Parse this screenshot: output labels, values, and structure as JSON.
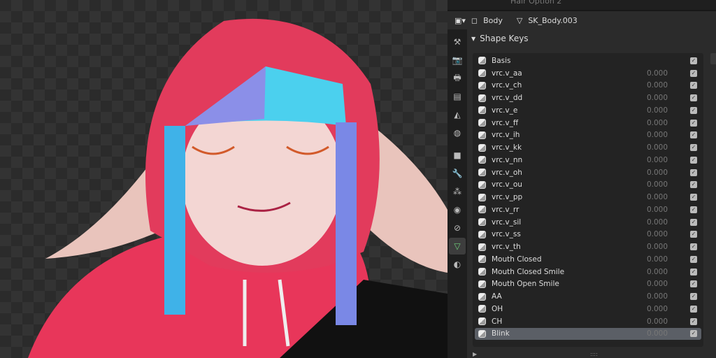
{
  "topbar": {
    "text": "Hair Option 2"
  },
  "header": {
    "object": "Body",
    "mesh": "SK_Body.003"
  },
  "panel": {
    "title": "Shape Keys"
  },
  "tabs": [
    "tool",
    "render",
    "output",
    "view-layer",
    "scene",
    "world",
    "object",
    "modifier",
    "particles",
    "physics",
    "constraints",
    "data",
    "material"
  ],
  "shape_keys": [
    {
      "name": "Basis",
      "value": "",
      "checked": true
    },
    {
      "name": "vrc.v_aa",
      "value": "0.000"
    },
    {
      "name": "vrc.v_ch",
      "value": "0.000"
    },
    {
      "name": "vrc.v_dd",
      "value": "0.000"
    },
    {
      "name": "vrc.v_e",
      "value": "0.000"
    },
    {
      "name": "vrc.v_ff",
      "value": "0.000"
    },
    {
      "name": "vrc.v_ih",
      "value": "0.000"
    },
    {
      "name": "vrc.v_kk",
      "value": "0.000"
    },
    {
      "name": "vrc.v_nn",
      "value": "0.000"
    },
    {
      "name": "vrc.v_oh",
      "value": "0.000"
    },
    {
      "name": "vrc.v_ou",
      "value": "0.000"
    },
    {
      "name": "vrc.v_pp",
      "value": "0.000"
    },
    {
      "name": "vrc.v_rr",
      "value": "0.000"
    },
    {
      "name": "vrc.v_sil",
      "value": "0.000"
    },
    {
      "name": "vrc.v_ss",
      "value": "0.000"
    },
    {
      "name": "vrc.v_th",
      "value": "0.000"
    },
    {
      "name": "Mouth Closed",
      "value": "0.000"
    },
    {
      "name": "Mouth Closed Smile",
      "value": "0.000"
    },
    {
      "name": "Mouth Open Smile",
      "value": "0.000"
    },
    {
      "name": "AA",
      "value": "0.000"
    },
    {
      "name": "OH",
      "value": "0.000"
    },
    {
      "name": "CH",
      "value": "0.000"
    },
    {
      "name": "Blink",
      "value": "0.000",
      "selected": true
    }
  ]
}
